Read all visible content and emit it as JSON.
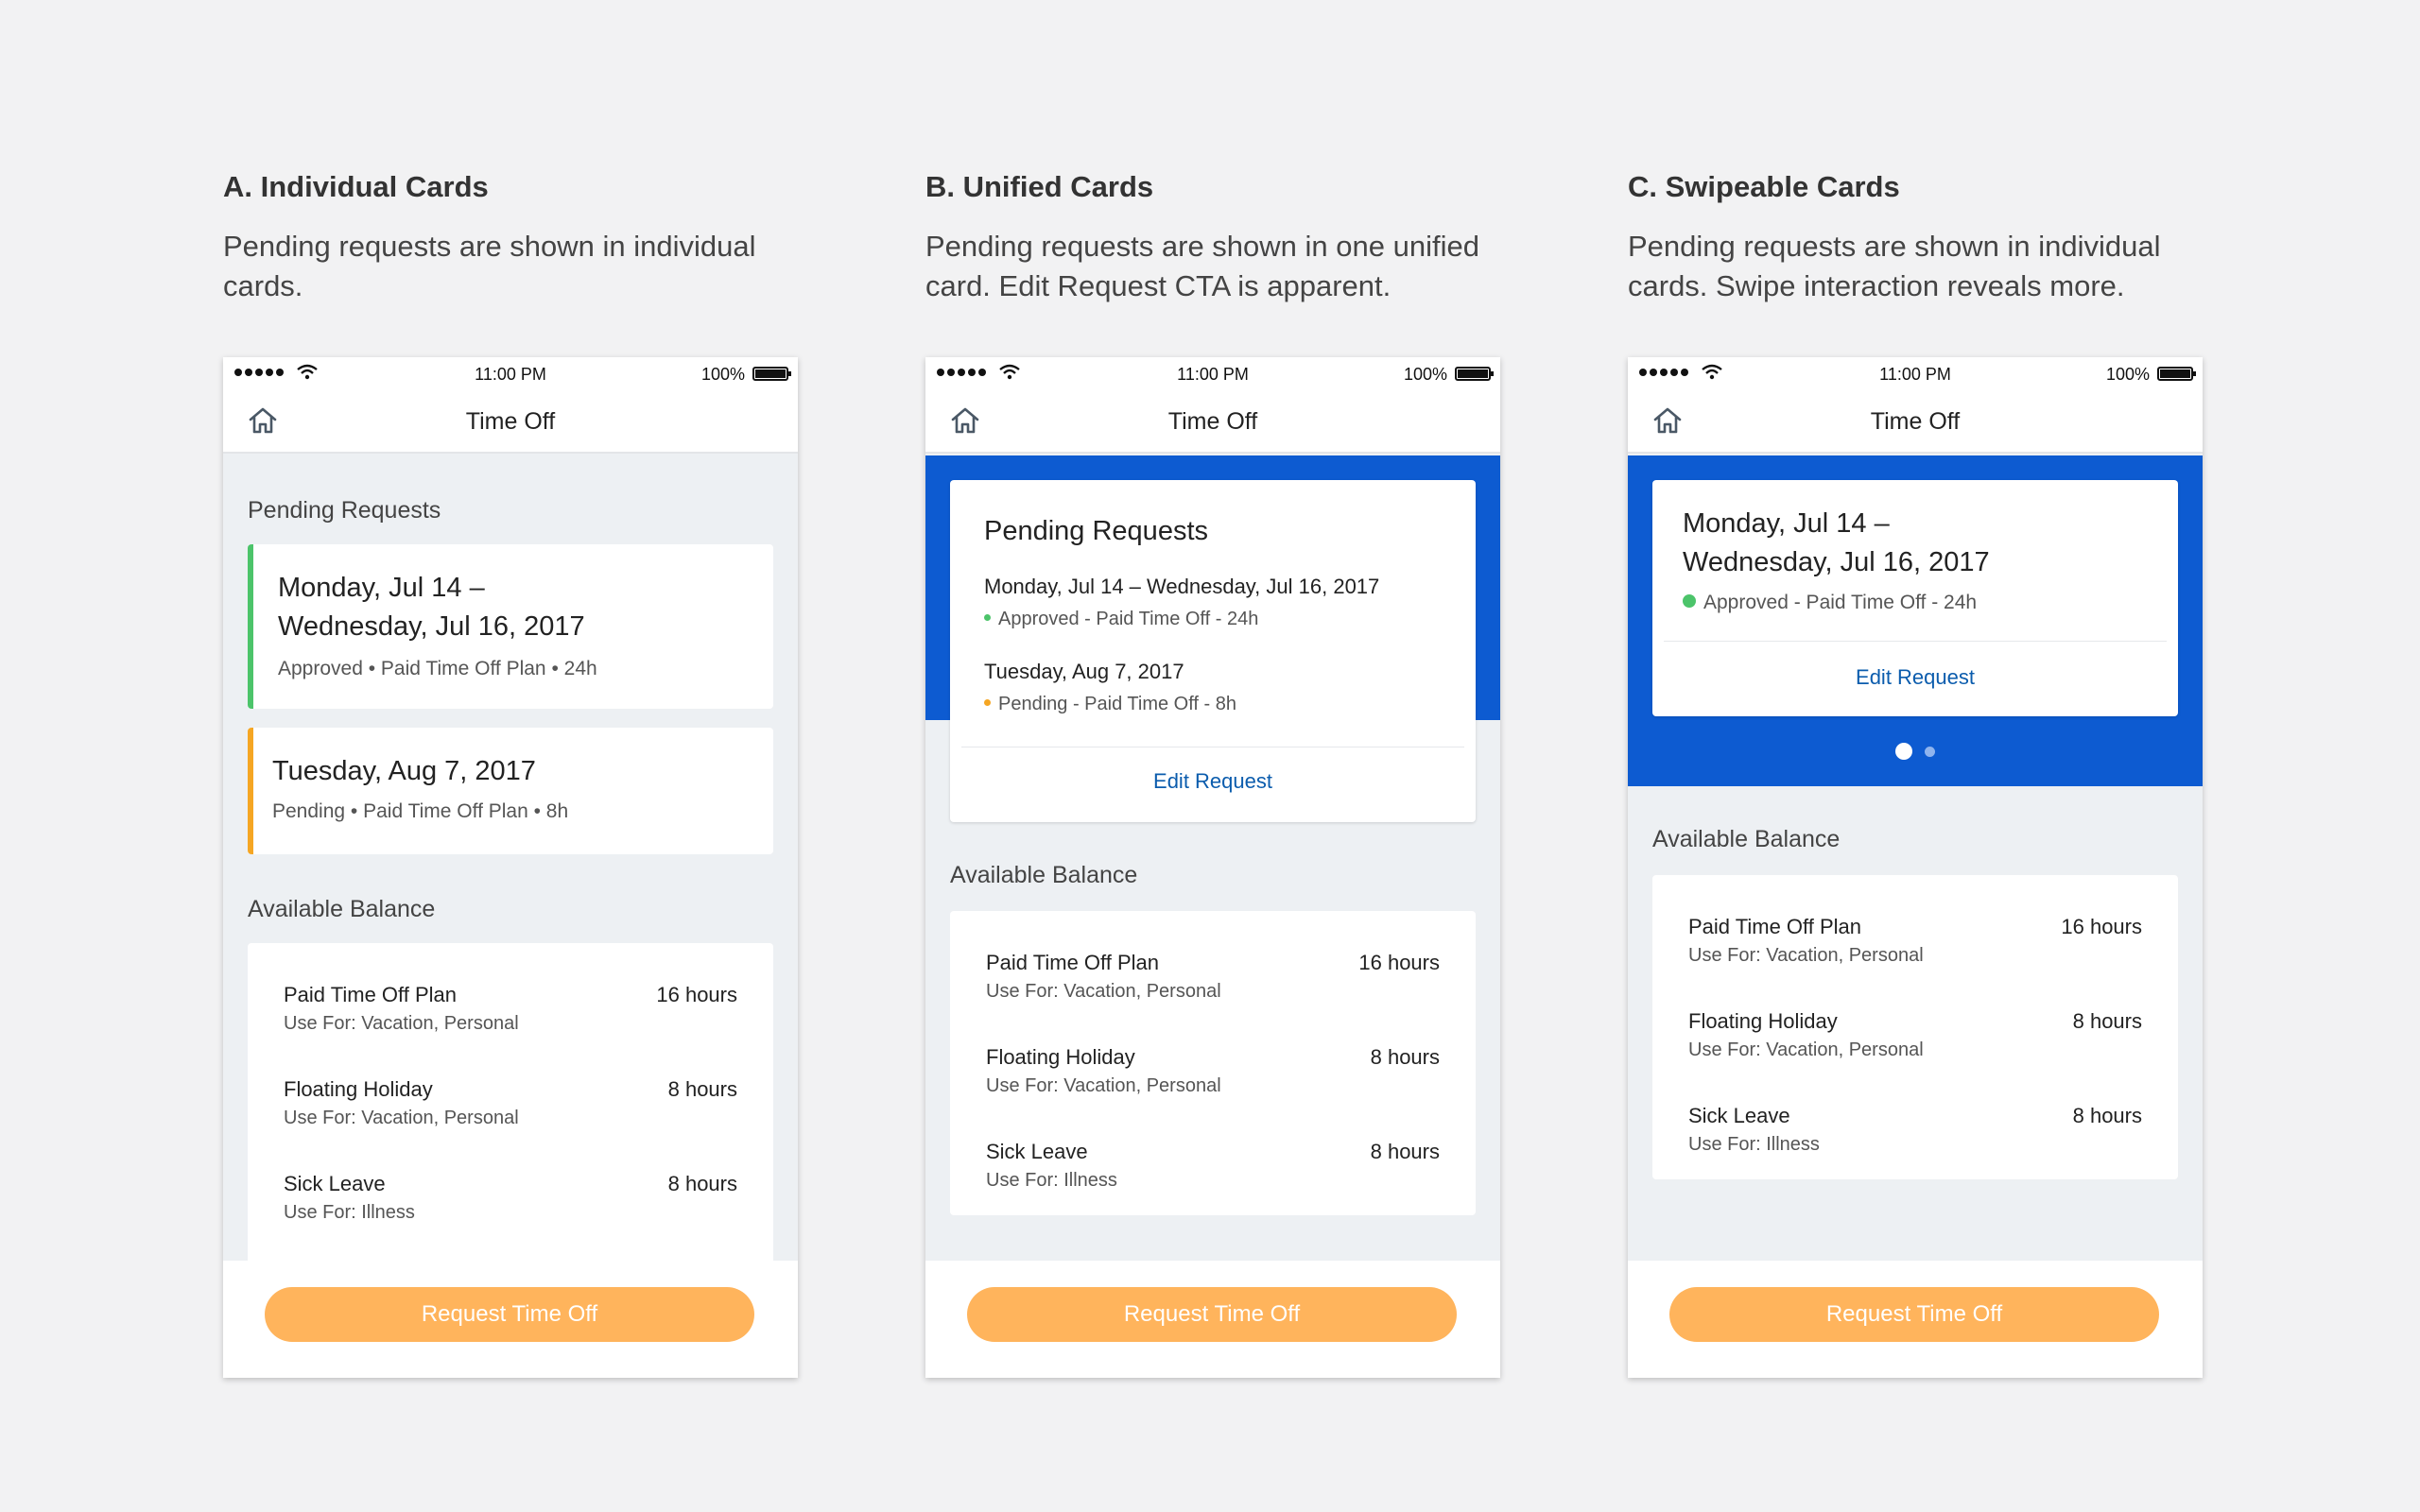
{
  "variants": {
    "a": {
      "heading": "A. Individual Cards",
      "description": "Pending requests are shown in individual cards."
    },
    "b": {
      "heading": "B. Unified Cards",
      "description": "Pending requests are shown in one unified card. Edit Request CTA is apparent."
    },
    "c": {
      "heading": "C. Swipeable Cards",
      "description": "Pending requests are shown in individual cards. Swipe interaction reveals more."
    }
  },
  "status_bar": {
    "time": "11:00 PM",
    "battery": "100%"
  },
  "nav": {
    "title": "Time Off"
  },
  "sections": {
    "pending": "Pending Requests",
    "balance": "Available Balance"
  },
  "requests_a": [
    {
      "date_line1": "Monday, Jul 14 –",
      "date_line2": "Wednesday, Jul 16, 2017",
      "status": "Approved • Paid Time Off Plan  • 24h",
      "color": "#4cc46a"
    },
    {
      "date_line1": "Tuesday, Aug 7, 2017",
      "status": "Pending • Paid Time Off Plan  • 8h",
      "color": "#f5a623"
    }
  ],
  "requests_b": [
    {
      "date": "Monday, Jul 14 –  Wednesday, Jul 16, 2017",
      "status": "Approved - Paid Time Off - 24h",
      "color": "#4cc46a"
    },
    {
      "date": "Tuesday, Aug 7, 2017",
      "status": "Pending - Paid Time Off - 8h",
      "color": "#f5a623"
    }
  ],
  "request_c": {
    "date_line1": "Monday, Jul 14 –",
    "date_line2": "Wednesday, Jul 16, 2017",
    "status": "Approved - Paid Time Off - 24h",
    "color": "#4cc46a"
  },
  "edit_label": "Edit Request",
  "balances": [
    {
      "name": "Paid Time Off Plan",
      "use": "Use For: Vacation, Personal",
      "hours": "16 hours"
    },
    {
      "name": "Floating Holiday",
      "use": "Use For: Vacation, Personal",
      "hours": "8 hours"
    },
    {
      "name": "Sick Leave",
      "use": "Use For: Illness",
      "hours": "8 hours"
    }
  ],
  "cta_label": "Request Time Off",
  "pager": {
    "current": 1,
    "total": 2
  },
  "colors": {
    "blue": "#0d5bd1",
    "cta": "#ffb45c",
    "approved": "#4cc46a",
    "pending": "#f5a623",
    "link": "#0b5cad"
  }
}
